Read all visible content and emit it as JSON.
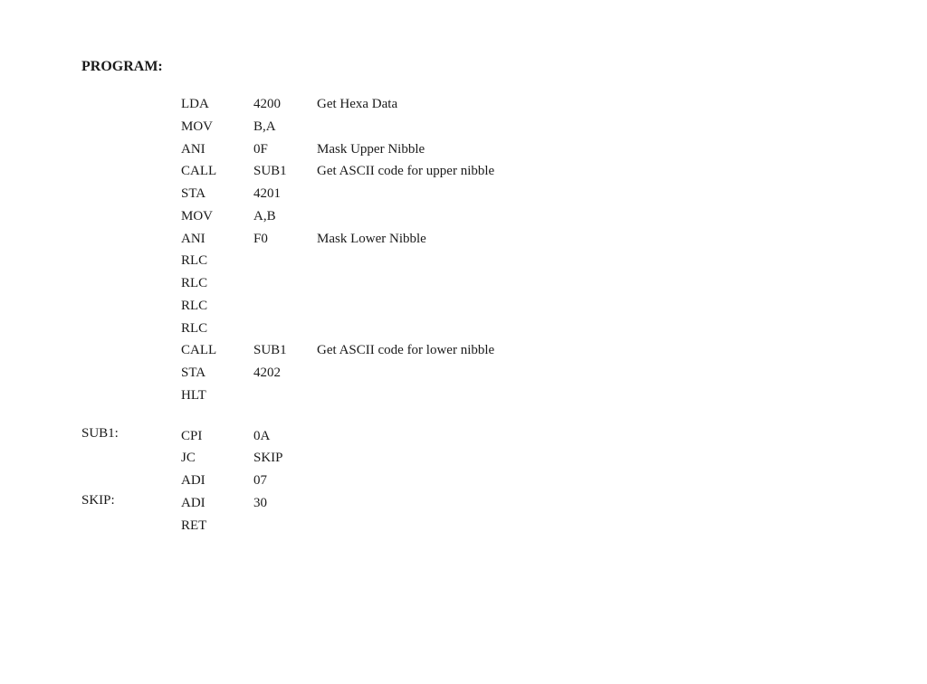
{
  "heading": "PROGRAM:",
  "mainInstructions": [
    {
      "mnemonic": "LDA",
      "operand": "4200",
      "comment": "Get Hexa Data"
    },
    {
      "mnemonic": "MOV",
      "operand": "B,A",
      "comment": ""
    },
    {
      "mnemonic": "ANI",
      "operand": "0F",
      "comment": "Mask Upper Nibble"
    },
    {
      "mnemonic": "CALL",
      "operand": "SUB1",
      "comment": "Get ASCII code for upper nibble"
    },
    {
      "mnemonic": "STA",
      "operand": "4201",
      "comment": ""
    },
    {
      "mnemonic": "MOV",
      "operand": "A,B",
      "comment": ""
    },
    {
      "mnemonic": "ANI",
      "operand": "F0",
      "comment": "Mask Lower Nibble"
    },
    {
      "mnemonic": "RLC",
      "operand": "",
      "comment": ""
    },
    {
      "mnemonic": "RLC",
      "operand": "",
      "comment": ""
    },
    {
      "mnemonic": "RLC",
      "operand": "",
      "comment": ""
    },
    {
      "mnemonic": "RLC",
      "operand": "",
      "comment": ""
    },
    {
      "mnemonic": "CALL",
      "operand": "SUB1",
      "comment": "Get ASCII code for lower nibble"
    },
    {
      "mnemonic": "STA",
      "operand": "4202",
      "comment": ""
    },
    {
      "mnemonic": "HLT",
      "operand": "",
      "comment": ""
    }
  ],
  "sub1Label": "SUB1:",
  "sub1Instructions": [
    {
      "mnemonic": "CPI",
      "operand": "0A",
      "comment": ""
    },
    {
      "mnemonic": "JC",
      "operand": "SKIP",
      "comment": ""
    },
    {
      "mnemonic": "ADI",
      "operand": "07",
      "comment": ""
    }
  ],
  "skipLabel": "SKIP:",
  "skipInstructions": [
    {
      "mnemonic": "ADI",
      "operand": "30",
      "comment": ""
    },
    {
      "mnemonic": "RET",
      "operand": "",
      "comment": ""
    }
  ]
}
